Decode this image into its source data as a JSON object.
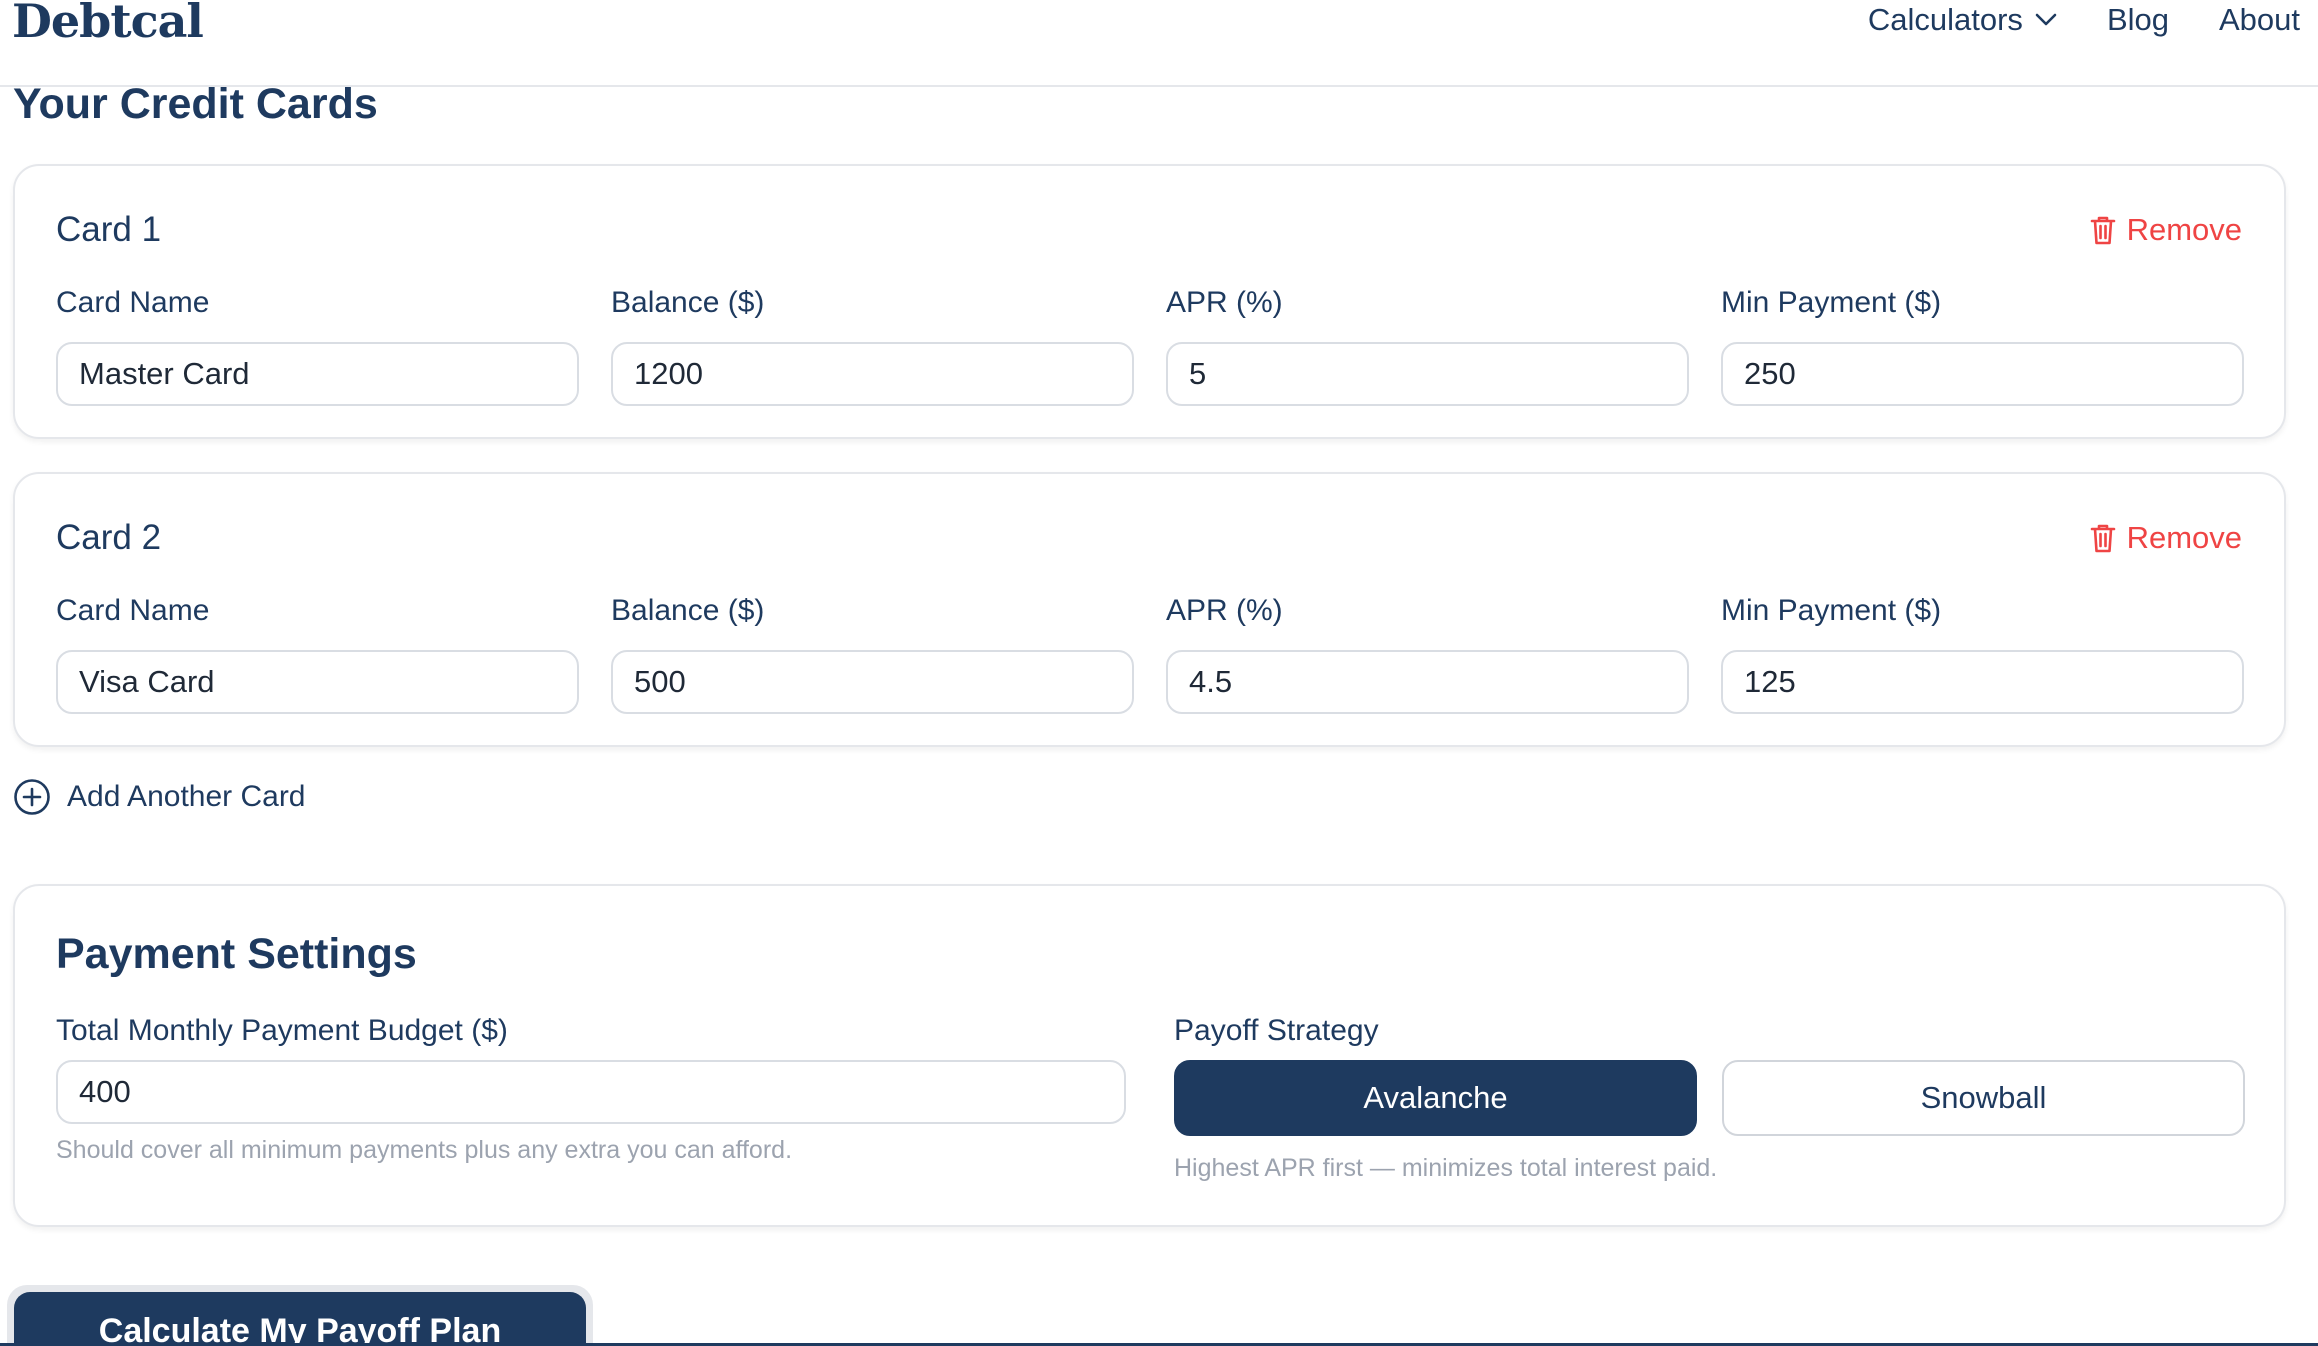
{
  "header": {
    "logo": "Debtcal",
    "nav": [
      {
        "label": "Calculators",
        "icon": "chevron-down-icon"
      },
      {
        "label": "Blog"
      },
      {
        "label": "About"
      }
    ]
  },
  "cards_section": {
    "title": "Your Credit Cards",
    "remove_label": "Remove",
    "labels": {
      "name": "Card Name",
      "balance": "Balance ($)",
      "apr": "APR (%)",
      "min_payment": "Min Payment ($)"
    },
    "cards": [
      {
        "heading": "Card 1",
        "name": "Master Card",
        "balance": "1200",
        "apr": "5",
        "min_payment": "250"
      },
      {
        "heading": "Card 2",
        "name": "Visa Card",
        "balance": "500",
        "apr": "4.5",
        "min_payment": "125"
      }
    ],
    "add_label": "Add Another Card"
  },
  "payment_settings": {
    "title": "Payment Settings",
    "budget_label": "Total Monthly Payment Budget ($)",
    "budget_value": "400",
    "budget_hint": "Should cover all minimum payments plus any extra you can afford.",
    "strategy_label": "Payoff Strategy",
    "strategies": [
      "Avalanche",
      "Snowball"
    ],
    "selected_strategy": "Avalanche",
    "strategy_hint": "Highest APR first — minimizes total interest paid."
  },
  "calculate_label": "Calculate My Payoff Plan",
  "colors": {
    "primary": "#1e3a5f",
    "danger": "#ef4444",
    "border": "#e5e7eb",
    "muted": "#9ca3af"
  }
}
